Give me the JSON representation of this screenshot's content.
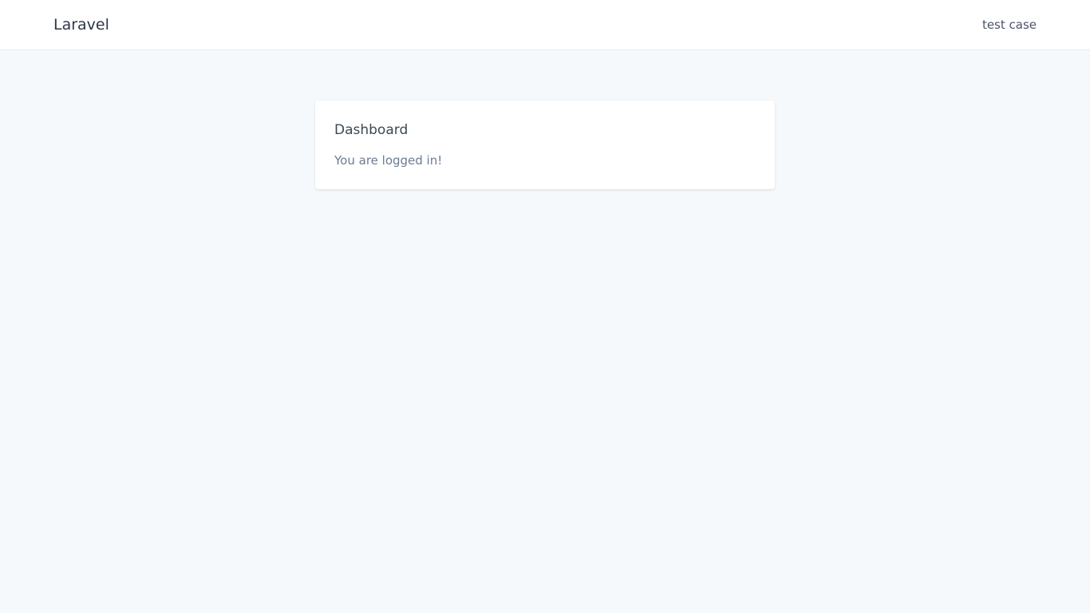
{
  "navbar": {
    "brand": "Laravel",
    "user_name": "test case"
  },
  "card": {
    "title": "Dashboard",
    "message": "You are logged in!"
  },
  "colors": {
    "page_background": "#f6f9fc",
    "navbar_background": "#ffffff",
    "card_background": "#ffffff",
    "title_text": "#3d4852",
    "muted_text": "#6b7c93"
  }
}
